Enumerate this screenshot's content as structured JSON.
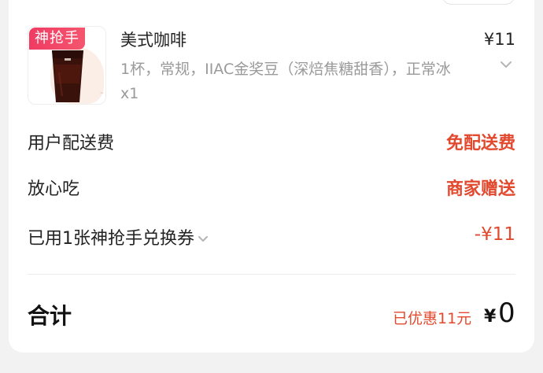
{
  "order_item": {
    "tag": "神抢手",
    "name": "美式咖啡",
    "price": "¥11",
    "description": "1杯，常规，IIAC金奖豆（深焙焦糖甜香），正常冰",
    "quantity": "x1",
    "image_icon": "iced-coffee-cup-icon"
  },
  "fees": {
    "delivery_label": "用户配送费",
    "delivery_value": "免配送费",
    "assurance_label": "放心吃",
    "assurance_value": "商家赠送",
    "coupon_label": "已用1张神抢手兑换券",
    "coupon_value": "-¥11"
  },
  "summary": {
    "total_label": "合计",
    "saved_text": "已优惠11元",
    "currency": "¥",
    "total_value": "0"
  },
  "colors": {
    "accent_red": "#e2492e",
    "tag_pink": "#f03b63",
    "text_dark": "#222222",
    "text_gray": "#9a9a9a"
  }
}
